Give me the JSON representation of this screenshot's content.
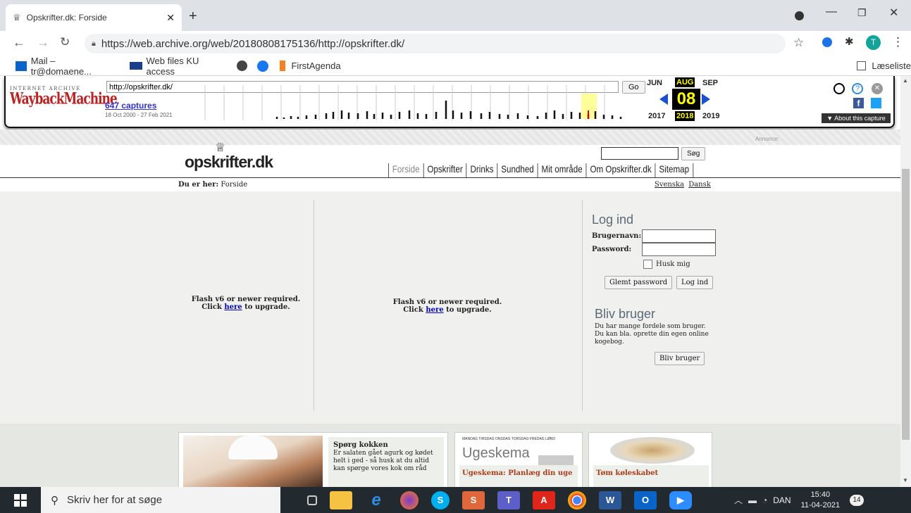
{
  "browser": {
    "tab_title": "Opskrifter.dk: Forside",
    "url": "https://web.archive.org/web/20180808175136/http://opskrifter.dk/",
    "bookmarks": [
      "Mail – tr@domaene...",
      "Web files KU access",
      "FirstAgenda"
    ],
    "reading_list": "Læseliste",
    "profile_initial": "T"
  },
  "wayback": {
    "logo_top": "INTERNET ARCHIVE",
    "logo_main": "WaybackMachine",
    "url_value": "http://opskrifter.dk/",
    "go": "Go",
    "captures": "647 captures",
    "range": "18 Oct 2000 - 27 Feb 2021",
    "months": [
      "JUN",
      "AUG",
      "SEP"
    ],
    "day": "08",
    "years": [
      "2017",
      "2018",
      "2019"
    ],
    "about": "▼ About this capture"
  },
  "site": {
    "ad_label": "Annonce:",
    "logo": "opskrifter.dk",
    "search_btn": "Søg",
    "nav": [
      "Forside",
      "Opskrifter",
      "Drinks",
      "Sundhed",
      "Mit område",
      "Om Opskrifter.dk",
      "Sitemap"
    ],
    "breadcrumb_label": "Du er her:",
    "breadcrumb_page": "Forside",
    "languages": [
      "Svenska",
      "Dansk"
    ],
    "flash1": {
      "line1": "Flash v6 or newer required.",
      "click": "Click ",
      "link": "here",
      "tail": " to upgrade."
    },
    "flash2": {
      "line1": "Flash v6 or newer required.",
      "click": "Click ",
      "link": "here",
      "tail": " to upgrade."
    },
    "login": {
      "title": "Log ind",
      "user_label": "Brugernavn:",
      "pass_label": "Password:",
      "remember": "Husk mig",
      "forgot": "Glemt password",
      "submit": "Log ind"
    },
    "signup": {
      "title": "Bliv bruger",
      "text": "Du har mange fordele som bruger. Du kan bla. oprette din egen online kogebog.",
      "button": "Bliv bruger"
    },
    "promo1": {
      "title": "Spørg kokken",
      "text": "Er salaten gået agurk og kødet helt i ged - så husk at du altid kan spørge vores kok om råd"
    },
    "promo2": {
      "image_text": "Ugeskema",
      "days": "MANDAG TIRSDAG ONSDAG TORSDAG FREDAG LØRD",
      "title": "Ugeskema: Planlæg din uge"
    },
    "promo3": {
      "title": "Tøm køleskabet"
    }
  },
  "taskbar": {
    "search": "Skriv her for at søge",
    "lang": "DAN",
    "time": "15:40",
    "date": "11-04-2021",
    "notif": "14"
  }
}
